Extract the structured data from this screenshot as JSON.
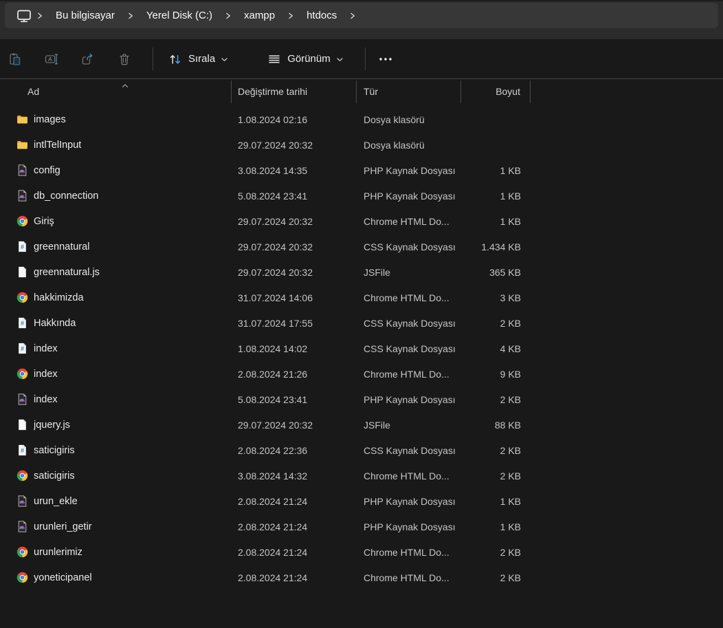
{
  "breadcrumb": {
    "items": [
      "Bu bilgisayar",
      "Yerel Disk (C:)",
      "xampp",
      "htdocs"
    ]
  },
  "toolbar": {
    "paste": "paste",
    "rename": "rename",
    "share": "share",
    "delete": "delete",
    "sort_label": "Sırala",
    "view_label": "Görünüm",
    "more": "see-more"
  },
  "columns": {
    "name": "Ad",
    "date": "Değiştirme tarihi",
    "type": "Tür",
    "size": "Boyut"
  },
  "sort": {
    "column": "Ad",
    "ascending": true
  },
  "colors": {
    "accent_blue": "#4ba0e8",
    "folder_yellow": "#f5c64f",
    "php_purple": "#9d6fc3",
    "css_blue": "#3f7f9f",
    "chrome_red": "#e8453c",
    "chrome_yellow": "#fcbd2e",
    "chrome_green": "#30a452",
    "chrome_blue": "#3b82ef"
  },
  "rows": [
    {
      "name": "images",
      "icon": "folder",
      "date": "1.08.2024 02:16",
      "type": "Dosya klasörü",
      "size": ""
    },
    {
      "name": "intlTelInput",
      "icon": "folder",
      "date": "29.07.2024 20:32",
      "type": "Dosya klasörü",
      "size": ""
    },
    {
      "name": "config",
      "icon": "php",
      "date": "3.08.2024 14:35",
      "type": "PHP Kaynak Dosyası",
      "size": "1 KB"
    },
    {
      "name": "db_connection",
      "icon": "php",
      "date": "5.08.2024 23:41",
      "type": "PHP Kaynak Dosyası",
      "size": "1 KB"
    },
    {
      "name": "Giriş",
      "icon": "chrome",
      "date": "29.07.2024 20:32",
      "type": "Chrome HTML Do...",
      "size": "1 KB"
    },
    {
      "name": "greennatural",
      "icon": "css",
      "date": "29.07.2024 20:32",
      "type": "CSS Kaynak Dosyası",
      "size": "1.434 KB"
    },
    {
      "name": "greennatural.js",
      "icon": "file",
      "date": "29.07.2024 20:32",
      "type": "JSFile",
      "size": "365 KB"
    },
    {
      "name": "hakkimizda",
      "icon": "chrome",
      "date": "31.07.2024 14:06",
      "type": "Chrome HTML Do...",
      "size": "3 KB"
    },
    {
      "name": "Hakkında",
      "icon": "css",
      "date": "31.07.2024 17:55",
      "type": "CSS Kaynak Dosyası",
      "size": "2 KB"
    },
    {
      "name": "index",
      "icon": "css",
      "date": "1.08.2024 14:02",
      "type": "CSS Kaynak Dosyası",
      "size": "4 KB"
    },
    {
      "name": "index",
      "icon": "chrome",
      "date": "2.08.2024 21:26",
      "type": "Chrome HTML Do...",
      "size": "9 KB"
    },
    {
      "name": "index",
      "icon": "php",
      "date": "5.08.2024 23:41",
      "type": "PHP Kaynak Dosyası",
      "size": "2 KB"
    },
    {
      "name": "jquery.js",
      "icon": "file",
      "date": "29.07.2024 20:32",
      "type": "JSFile",
      "size": "88 KB"
    },
    {
      "name": "saticigiris",
      "icon": "css",
      "date": "2.08.2024 22:36",
      "type": "CSS Kaynak Dosyası",
      "size": "2 KB"
    },
    {
      "name": "saticigiris",
      "icon": "chrome",
      "date": "3.08.2024 14:32",
      "type": "Chrome HTML Do...",
      "size": "2 KB"
    },
    {
      "name": "urun_ekle",
      "icon": "php",
      "date": "2.08.2024 21:24",
      "type": "PHP Kaynak Dosyası",
      "size": "1 KB"
    },
    {
      "name": "urunleri_getir",
      "icon": "php",
      "date": "2.08.2024 21:24",
      "type": "PHP Kaynak Dosyası",
      "size": "1 KB"
    },
    {
      "name": "urunlerimiz",
      "icon": "chrome",
      "date": "2.08.2024 21:24",
      "type": "Chrome HTML Do...",
      "size": "2 KB"
    },
    {
      "name": "yoneticipanel",
      "icon": "chrome",
      "date": "2.08.2024 21:24",
      "type": "Chrome HTML Do...",
      "size": "2 KB"
    }
  ]
}
